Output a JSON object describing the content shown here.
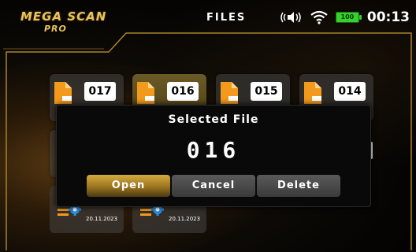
{
  "header": {
    "logo_line1": "MEGA SCAN",
    "logo_line2": "PRO",
    "title": "FILES",
    "battery_label": "100",
    "time": "00:13"
  },
  "file_grid": {
    "row1": [
      {
        "number": "017",
        "selected": false
      },
      {
        "number": "016",
        "selected": true
      },
      {
        "number": "015",
        "selected": false
      },
      {
        "number": "014",
        "selected": false
      }
    ],
    "row3": [
      {
        "date": "20.11.2023"
      },
      {
        "date": "20.11.2023"
      }
    ]
  },
  "modal": {
    "title": "Selected File",
    "file_number": "016",
    "buttons": {
      "open": "Open",
      "cancel": "Cancel",
      "delete": "Delete"
    }
  },
  "colors": {
    "accent_gold": "#d4ab3e",
    "battery_green": "#36d12c",
    "file_orange": "#f39a1d"
  }
}
